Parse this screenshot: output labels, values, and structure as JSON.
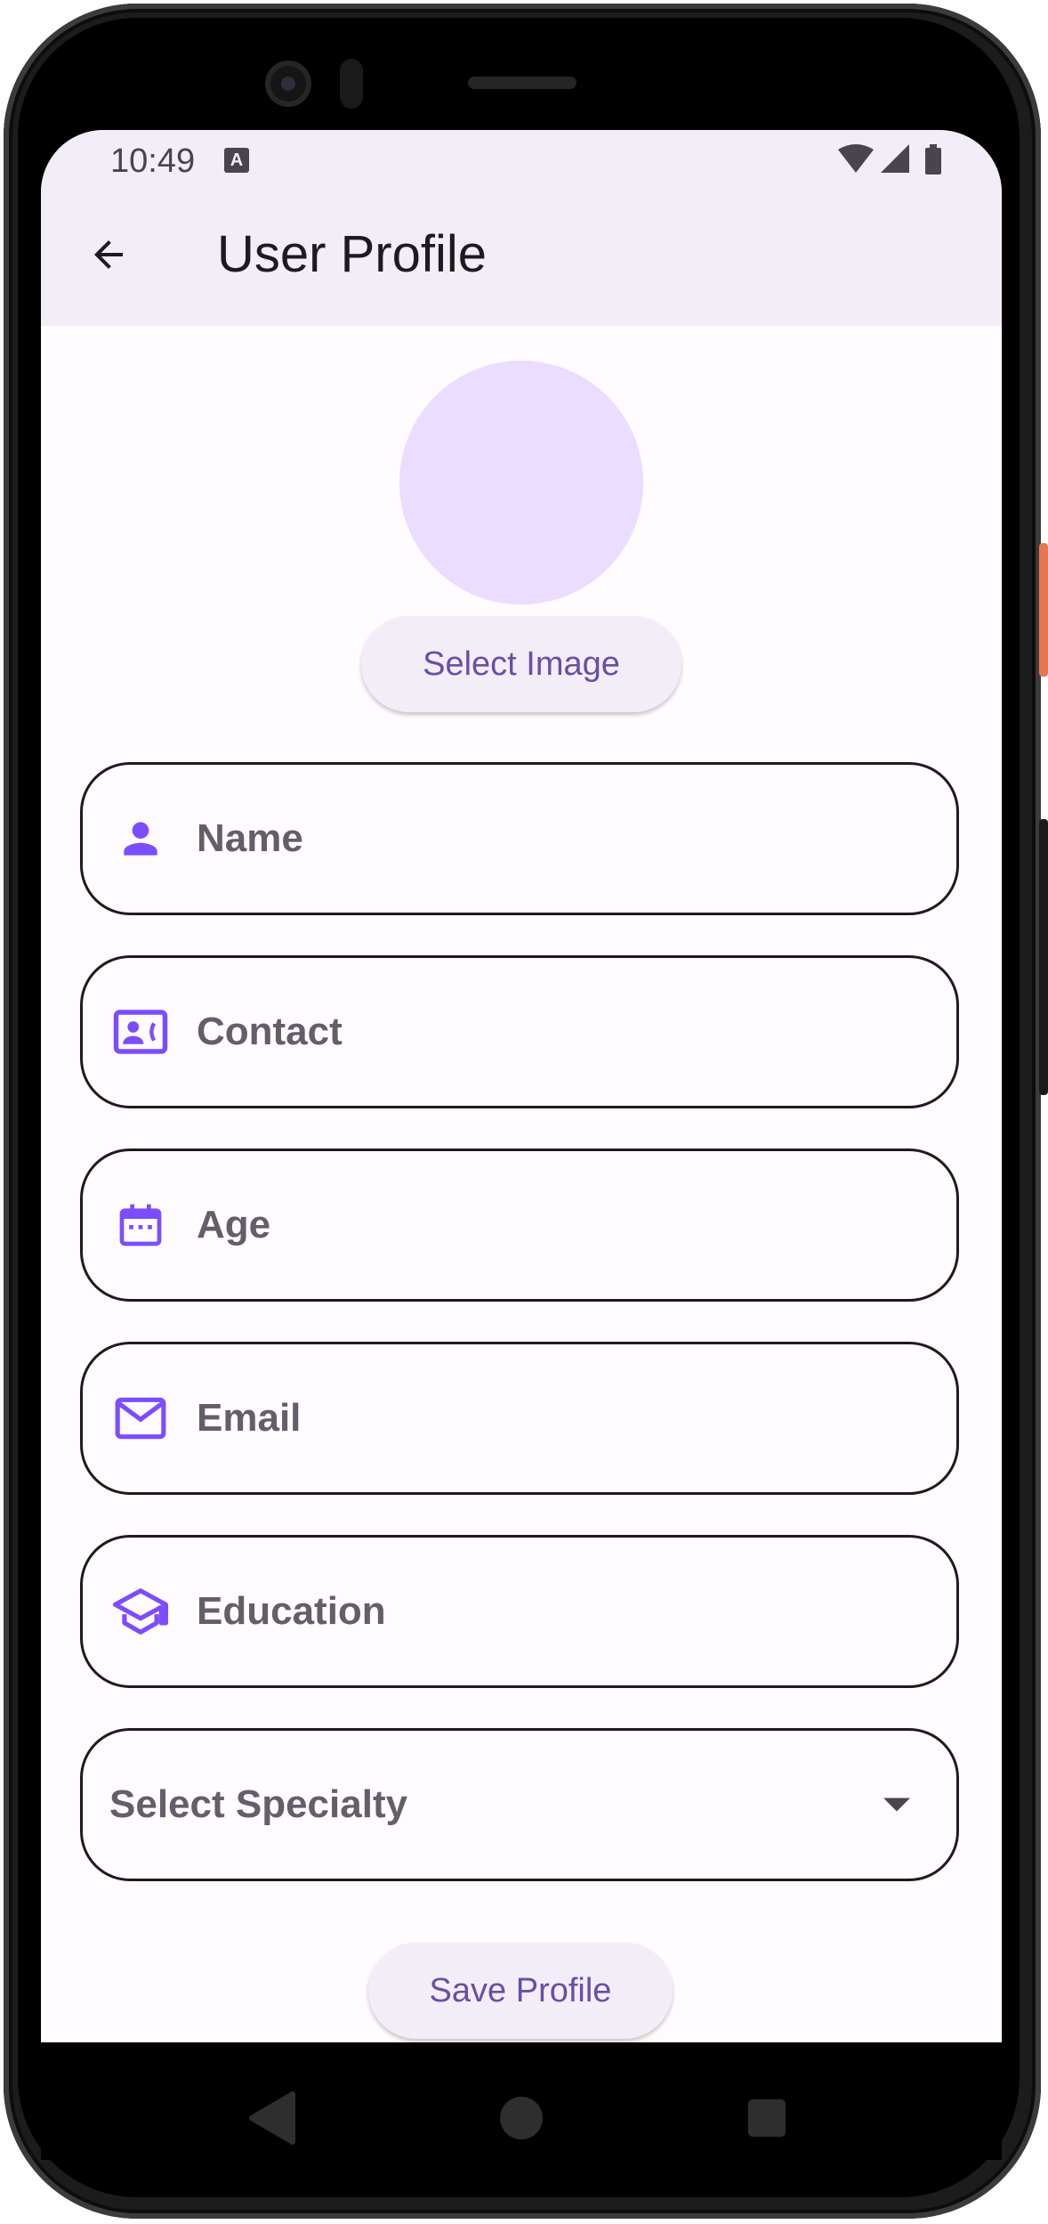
{
  "status_bar": {
    "time": "10:49",
    "keyboard_badge": "A"
  },
  "app_bar": {
    "title": "User Profile",
    "back_icon": "arrow-back-icon"
  },
  "profile": {
    "select_image_label": "Select Image"
  },
  "form": {
    "fields": [
      {
        "label": "Name",
        "icon": "person-icon"
      },
      {
        "label": "Contact",
        "icon": "contact-card-icon"
      },
      {
        "label": "Age",
        "icon": "calendar-icon"
      },
      {
        "label": "Email",
        "icon": "mail-icon"
      },
      {
        "label": "Education",
        "icon": "school-icon"
      }
    ],
    "specialty_placeholder": "Select Specialty",
    "save_label": "Save Profile"
  },
  "colors": {
    "accent": "#7c4dff",
    "primary_text": "#6750a4",
    "surface": "#fffbfe",
    "surface_container": "#f3edf7",
    "avatar": "#eaddff"
  }
}
